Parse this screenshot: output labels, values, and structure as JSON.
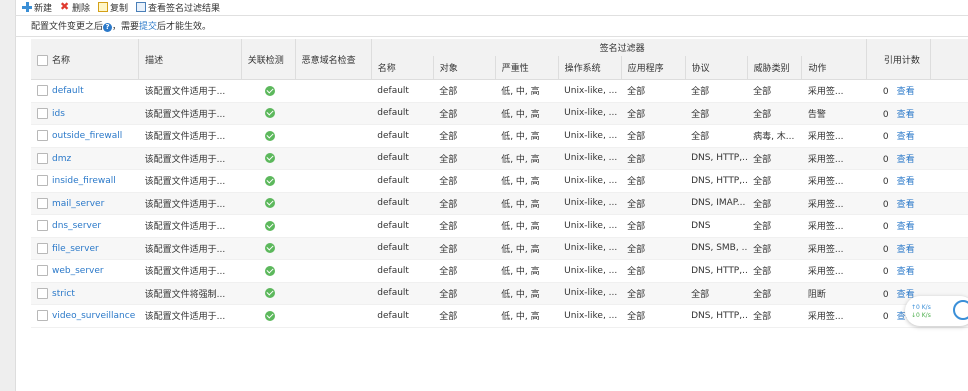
{
  "toolbar": {
    "new_label": "新建",
    "delete_label": "删除",
    "copy_label": "复制",
    "view_result_label": "查看签名过滤结果"
  },
  "notice": {
    "prefix": "配置文件变更之后",
    "middle": "，需要",
    "link": "提交",
    "suffix": "后才能生效。"
  },
  "table": {
    "headers": {
      "name": "名称",
      "description": "描述",
      "correlation": "关联检测",
      "malicious_domain": "恶意域名检查",
      "signature_filter": "签名过滤器",
      "ref_count": "引用计数",
      "edit": "编辑"
    },
    "sub_headers": [
      "名称",
      "对象",
      "严重性",
      "操作系统",
      "应用程序",
      "协议",
      "威胁类别",
      "动作"
    ],
    "rows": [
      {
        "name": "default",
        "desc": "该配置文件适用于...",
        "f_name": "default",
        "object": "全部",
        "severity": "低, 中, 高",
        "os": "Unix-like, ...",
        "app": "全部",
        "protocol": "全部",
        "threat": "全部",
        "action": "采用签...",
        "count": "0",
        "view": "查看"
      },
      {
        "name": "ids",
        "desc": "该配置文件适用于...",
        "f_name": "default",
        "object": "全部",
        "severity": "低, 中, 高",
        "os": "Unix-like, ...",
        "app": "全部",
        "protocol": "全部",
        "threat": "全部",
        "action": "告警",
        "count": "0",
        "view": "查看"
      },
      {
        "name": "outside_firewall",
        "desc": "该配置文件适用于...",
        "f_name": "default",
        "object": "全部",
        "severity": "低, 中, 高",
        "os": "Unix-like, ...",
        "app": "全部",
        "protocol": "全部",
        "threat": "病毒, 木...",
        "action": "采用签...",
        "count": "0",
        "view": "查看"
      },
      {
        "name": "dmz",
        "desc": "该配置文件适用于...",
        "f_name": "default",
        "object": "全部",
        "severity": "低, 中, 高",
        "os": "Unix-like, ...",
        "app": "全部",
        "protocol": "DNS, HTTP,...",
        "threat": "全部",
        "action": "采用签...",
        "count": "0",
        "view": "查看"
      },
      {
        "name": "inside_firewall",
        "desc": "该配置文件适用于...",
        "f_name": "default",
        "object": "全部",
        "severity": "低, 中, 高",
        "os": "Unix-like, ...",
        "app": "全部",
        "protocol": "DNS, HTTP,...",
        "threat": "全部",
        "action": "采用签...",
        "count": "0",
        "view": "查看"
      },
      {
        "name": "mail_server",
        "desc": "该配置文件适用于...",
        "f_name": "default",
        "object": "全部",
        "severity": "低, 中, 高",
        "os": "Unix-like, ...",
        "app": "全部",
        "protocol": "DNS, IMAP...",
        "threat": "全部",
        "action": "采用签...",
        "count": "0",
        "view": "查看"
      },
      {
        "name": "dns_server",
        "desc": "该配置文件适用于...",
        "f_name": "default",
        "object": "全部",
        "severity": "低, 中, 高",
        "os": "Unix-like, ...",
        "app": "全部",
        "protocol": "DNS",
        "threat": "全部",
        "action": "采用签...",
        "count": "0",
        "view": "查看"
      },
      {
        "name": "file_server",
        "desc": "该配置文件适用于...",
        "f_name": "default",
        "object": "全部",
        "severity": "低, 中, 高",
        "os": "Unix-like, ...",
        "app": "全部",
        "protocol": "DNS, SMB, ...",
        "threat": "全部",
        "action": "采用签...",
        "count": "0",
        "view": "查看"
      },
      {
        "name": "web_server",
        "desc": "该配置文件适用于...",
        "f_name": "default",
        "object": "全部",
        "severity": "低, 中, 高",
        "os": "Unix-like, ...",
        "app": "全部",
        "protocol": "DNS, HTTP,...",
        "threat": "全部",
        "action": "采用签...",
        "count": "0",
        "view": "查看"
      },
      {
        "name": "strict",
        "desc": "该配置文件将强制...",
        "f_name": "default",
        "object": "全部",
        "severity": "低, 中, 高",
        "os": "Unix-like, ...",
        "app": "全部",
        "protocol": "全部",
        "threat": "全部",
        "action": "阻断",
        "count": "0",
        "view": "查看"
      },
      {
        "name": "video_surveillance",
        "desc": "该配置文件适用于...",
        "f_name": "default",
        "object": "全部",
        "severity": "低, 中, 高",
        "os": "Unix-like, ...",
        "app": "全部",
        "protocol": "DNS, HTTP,...",
        "threat": "全部",
        "action": "采用签...",
        "count": "0",
        "view": "查看"
      }
    ]
  },
  "net_widget": {
    "up": "↑0  K/s",
    "down": "↓0  K/s"
  }
}
